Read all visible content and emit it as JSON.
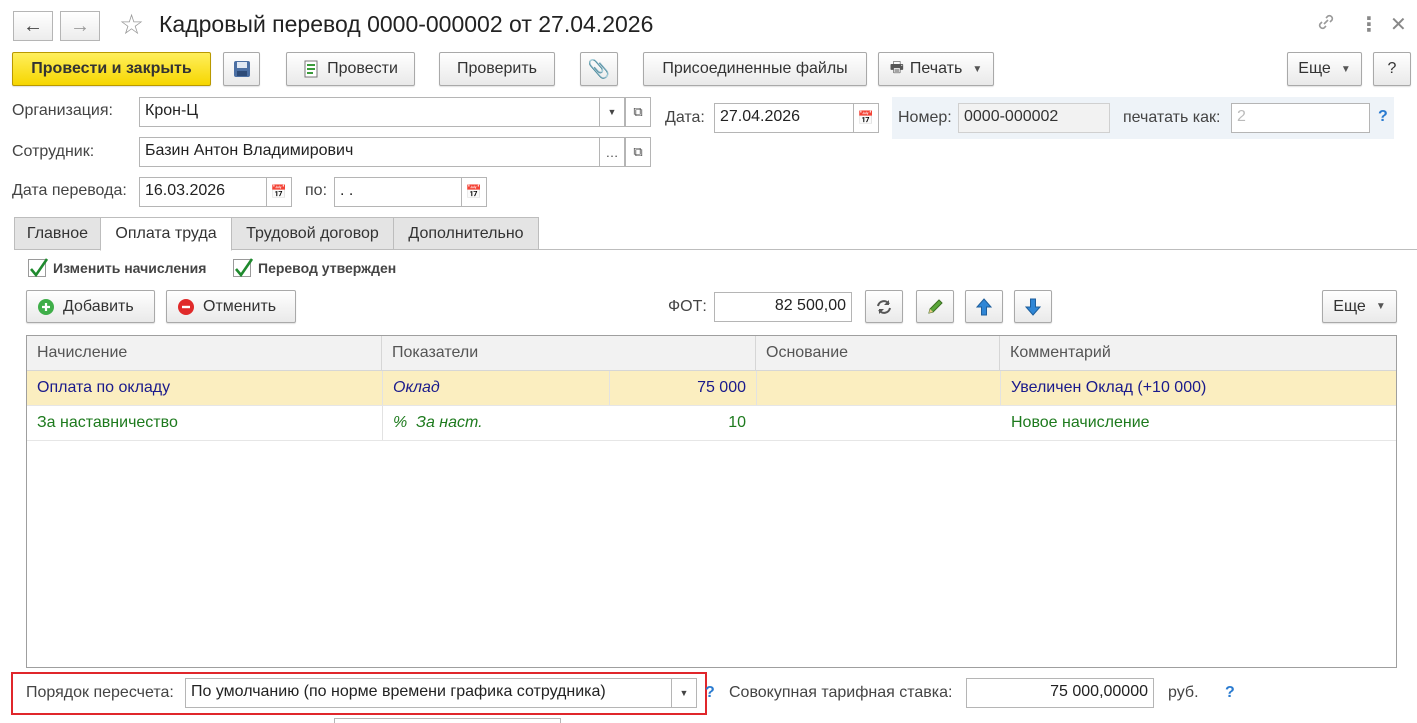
{
  "window": {
    "title": "Кадровый перевод 0000-000002 от 27.04.2026",
    "nav_back_icon": "arrow-left-icon",
    "nav_forward_icon": "arrow-right-icon"
  },
  "toolbar": {
    "post_close": "Провести и закрыть",
    "post": "Провести",
    "check": "Проверить",
    "attached_files": "Присоединенные файлы",
    "print": "Печать",
    "more": "Еще",
    "help": "?"
  },
  "header": {
    "organization_label": "Организация:",
    "organization_value": "Крон-Ц",
    "date_label": "Дата:",
    "date_value": "27.04.2026",
    "number_label": "Номер:",
    "number_value": "0000-000002",
    "print_as_label": "печатать как:",
    "print_as_value": "2",
    "help_mark": "?",
    "employee_label": "Сотрудник:",
    "employee_value": "Базин Антон Владимирович",
    "transfer_date_label": "Дата перевода:",
    "transfer_date_value": "16.03.2026",
    "to_label": "по:",
    "to_value": " .  ."
  },
  "tabs": [
    {
      "label": "Главное"
    },
    {
      "label": "Оплата труда"
    },
    {
      "label": "Трудовой договор"
    },
    {
      "label": "Дополнительно"
    }
  ],
  "pay": {
    "change_accruals_label": "Изменить начисления",
    "change_accruals_checked": true,
    "transfer_approved_label": "Перевод утвержден",
    "transfer_approved_checked": true,
    "add": "Добавить",
    "cancel": "Отменить",
    "fot_label": "ФОТ:",
    "fot_value": "82 500,00",
    "more": "Еще"
  },
  "table": {
    "columns": [
      "Начисление",
      "Показатели",
      "Основание",
      "Комментарий"
    ],
    "rows": [
      {
        "accrual": "Оплата по окладу",
        "indicator": "Оклад",
        "value": "75 000",
        "basis": "",
        "comment": "Увеличен Оклад (+10 000)",
        "selected": true
      },
      {
        "accrual": "За наставничество",
        "indicator": "%  За наст.",
        "value": "10",
        "basis": "",
        "comment": "Новое начисление",
        "selected": false
      }
    ]
  },
  "footer": {
    "recalc_label": "Порядок пересчета:",
    "recalc_value": "По умолчанию (по норме времени графика сотрудника)",
    "help_mark": "?",
    "rate_label": "Совокупная тарифная ставка:",
    "rate_value": "75 000,00000",
    "currency": "руб.",
    "help_mark2": "?"
  },
  "colors": {
    "primary_button": "#f6d600",
    "selected_row": "#fbeec0",
    "highlight_border": "#e0262b",
    "row1_text": "#1a1a8c",
    "row2_text": "#1d7a1d"
  }
}
